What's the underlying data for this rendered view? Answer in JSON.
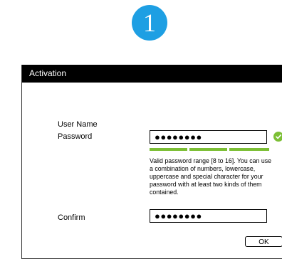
{
  "step": {
    "number": "1",
    "color": "#1e9fe3"
  },
  "dialog": {
    "title": "Activation",
    "fields": {
      "username_label": "User Name",
      "password_label": "Password",
      "password_value": "●●●●●●●●",
      "confirm_label": "Confirm",
      "confirm_value": "●●●●●●●●"
    },
    "password_valid_icon": "check-circle-icon",
    "valid_color": "#7cbf35",
    "strength_segments_filled": 3,
    "strength_segments_total": 3,
    "hint": "Valid password range [8 to 16]. You can use a combination of numbers, lowercase, uppercase and special character for your password with at least two kinds of them contained.",
    "ok_label": "OK"
  }
}
